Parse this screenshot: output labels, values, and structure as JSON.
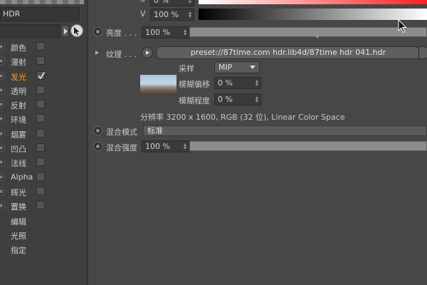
{
  "window": {
    "title": "HDR"
  },
  "left_panel": {
    "filter_value": "",
    "channels": [
      {
        "label": "颜色",
        "checked": false,
        "active": false
      },
      {
        "label": "漫射",
        "checked": false,
        "active": false
      },
      {
        "label": "发光",
        "checked": true,
        "active": true
      },
      {
        "label": "透明",
        "checked": false,
        "active": false
      },
      {
        "label": "反射",
        "checked": false,
        "active": false
      },
      {
        "label": "环境",
        "checked": false,
        "active": false
      },
      {
        "label": "烟雾",
        "checked": false,
        "active": false
      },
      {
        "label": "凹凸",
        "checked": false,
        "active": false
      },
      {
        "label": "法线",
        "checked": false,
        "active": false
      },
      {
        "label": "Alpha",
        "checked": false,
        "active": false
      },
      {
        "label": "辉光",
        "checked": false,
        "active": false
      },
      {
        "label": "置换",
        "checked": false,
        "active": false
      }
    ],
    "extra_items": [
      "编辑",
      "光照",
      "指定"
    ],
    "active_color": "#f0a030"
  },
  "color": {
    "s_label": "S",
    "s_value": "0 %",
    "v_label": "V",
    "v_value": "100 %"
  },
  "brightness": {
    "label": "亮度 . . .",
    "value": "100 %",
    "fraction": 1.0
  },
  "texture": {
    "label": "纹理 . . .",
    "path": "preset://87time.com hdr.lib4d/87time hdr 041.hdr",
    "sampling_label": "采样",
    "sampling_value": "MIP",
    "blur_offset_label": "模糊偏移",
    "blur_offset_value": "0 %",
    "blur_scale_label": "模糊程度",
    "blur_scale_value": "0 %",
    "info": "分辨率 3200 x 1600, RGB (32 位), Linear Color Space"
  },
  "mix_mode": {
    "label": "混合模式",
    "value": "标准"
  },
  "mix_strength": {
    "label": "混合强度",
    "value": "100 %",
    "fraction": 1.0
  },
  "icons": {
    "filter_arrow": "triangle-right-icon",
    "pick": "pointer-arrow-icon",
    "check": "checkmark-icon"
  }
}
